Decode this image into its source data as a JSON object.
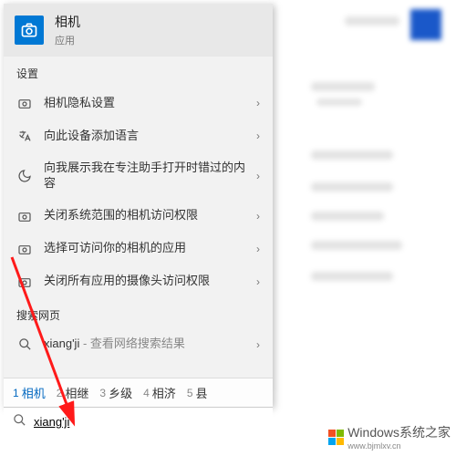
{
  "bestMatch": {
    "title": "相机",
    "subtitle": "应用"
  },
  "sections": {
    "settings": "设置",
    "web": "搜索网页"
  },
  "settingsItems": [
    "相机隐私设置",
    "向此设备添加语言",
    "向我展示我在专注助手打开时错过的内容",
    "关闭系统范围的相机访问权限",
    "选择可访问你的相机的应用",
    "关闭所有应用的摄像头访问权限"
  ],
  "webSearch": {
    "term": "xiang'ji",
    "hint": " - 查看网络搜索结果"
  },
  "ime": {
    "candidates": [
      {
        "num": "1",
        "text": "相机"
      },
      {
        "num": "2",
        "text": "相继"
      },
      {
        "num": "3",
        "text": "乡级"
      },
      {
        "num": "4",
        "text": "相济"
      },
      {
        "num": "5",
        "text": "县"
      }
    ]
  },
  "searchInput": {
    "value": "xiang'ji"
  },
  "watermark": {
    "brand": "Windows",
    "tagline": "系统之家",
    "url": "www.bjmlxv.cn"
  }
}
